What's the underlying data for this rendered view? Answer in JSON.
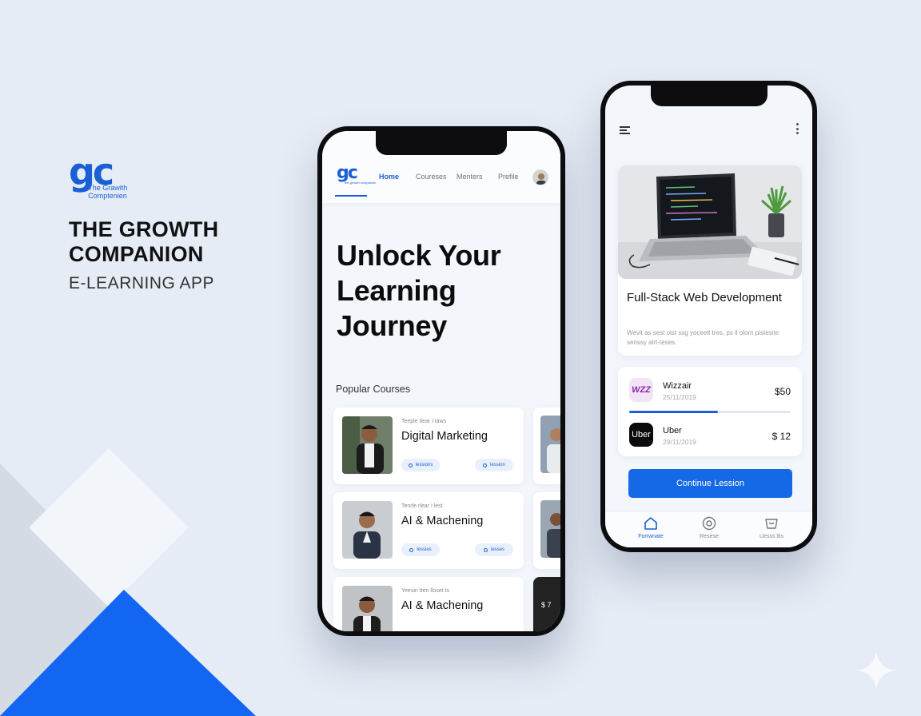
{
  "brand": {
    "logo_mark": "gc",
    "logo_subtitle": "The Grawith Comptenien",
    "title": "THE GROWTH COMPANION",
    "subtitle": "E-LEARNING APP"
  },
  "colors": {
    "accent": "#1a5fd6",
    "button": "#1569e6",
    "background": "#e6ecf5"
  },
  "phone1": {
    "nav": {
      "logo": "gc",
      "logo_sub": "the growth companion",
      "items": [
        {
          "label": "Home",
          "active": true
        },
        {
          "label": "Coureses",
          "active": false
        },
        {
          "label": "Menters",
          "active": false
        },
        {
          "label": "Prefile",
          "active": false
        }
      ],
      "avatar_icon": "user-avatar"
    },
    "hero_title": "Unlock Your Learning Journey",
    "section_title": "Popular Courses",
    "courses": [
      {
        "meta": "Teeple tlear I laws",
        "title": "Digital Marketing",
        "chip1": "lessions",
        "chip2": "lession"
      },
      {
        "meta": "Tenrle rlear I lest",
        "title": "AI & Machening",
        "chip1": "lessies",
        "chip2": "lesses"
      },
      {
        "meta": "Yeesin tten lloset ts",
        "title": "AI & Machening"
      }
    ],
    "side_badge": "$ 7"
  },
  "phone2": {
    "menu_icon": "hamburger-icon",
    "more_icon": "more-vertical-icon",
    "course_card": {
      "title": "Full-Stack Web Development",
      "description": "Wevit as sest oist ssg yoceelt tres, ps il olorn pistesite senssy alrt-teses."
    },
    "payments": [
      {
        "logo": "WZZ",
        "name": "Wizzair",
        "date": "25/11/2019",
        "amount": "$50",
        "logo_bg": "#f2e3f7",
        "logo_color": "#8a2aa8"
      },
      {
        "logo": "Uber",
        "name": "Uber",
        "date": "29/11/2019",
        "amount": "$ 12",
        "logo_bg": "#0b0b0b",
        "logo_color": "#ffffff"
      }
    ],
    "progress": 0.55,
    "button_label": "Continue Lession",
    "tabs": [
      {
        "label": "Forrwnate",
        "icon": "home-icon",
        "active": true
      },
      {
        "label": "Resese",
        "icon": "target-icon",
        "active": false
      },
      {
        "label": "Uesss ltis",
        "icon": "bag-icon",
        "active": false
      }
    ]
  }
}
